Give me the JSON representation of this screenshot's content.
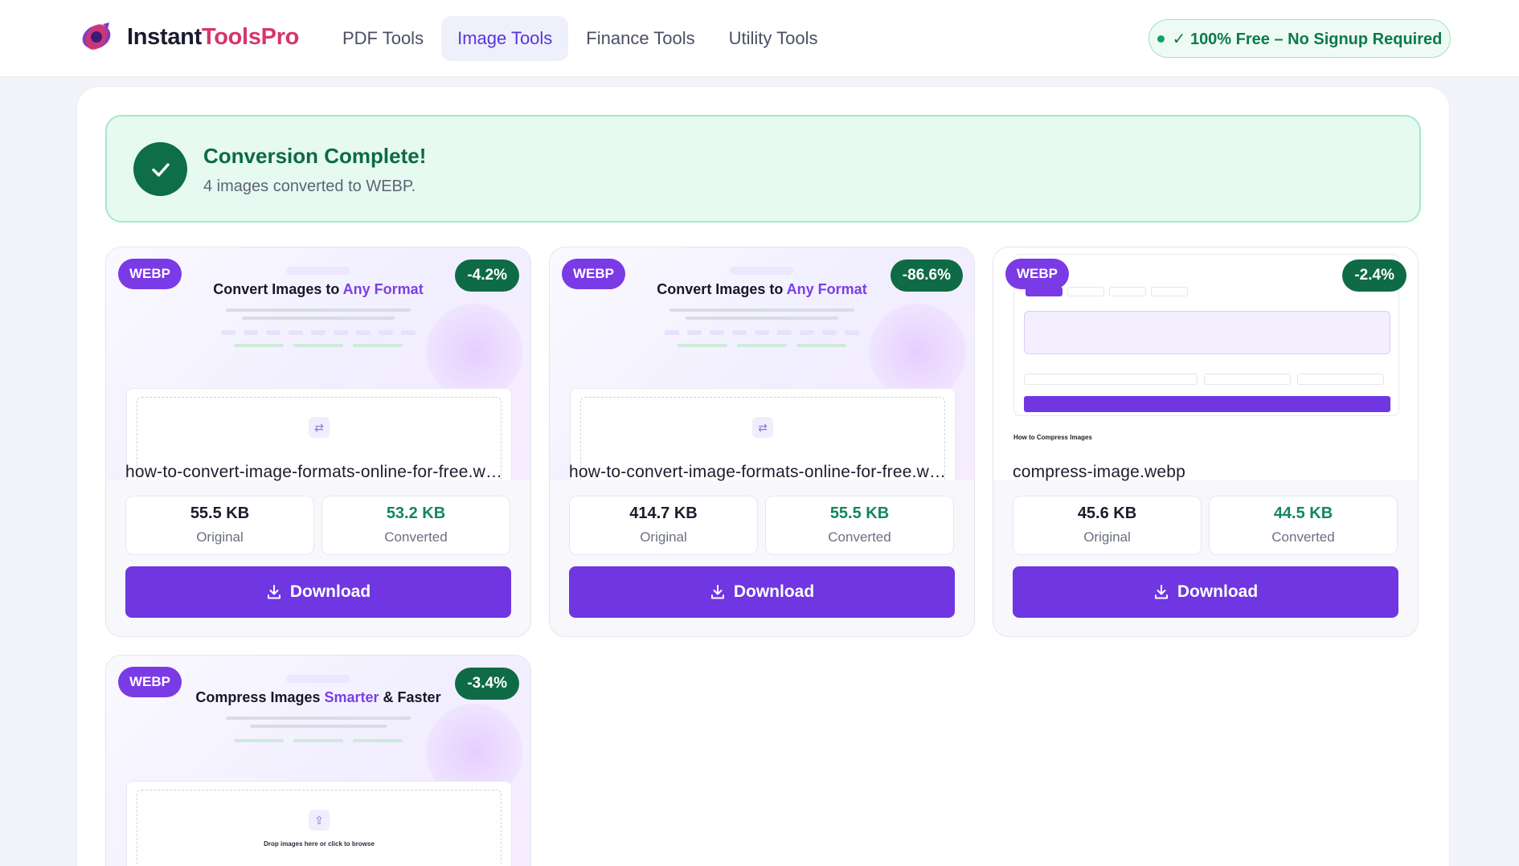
{
  "header": {
    "brand_part1": "Instant",
    "brand_part2": "ToolsPro",
    "nav": [
      {
        "label": "PDF Tools",
        "active": false
      },
      {
        "label": "Image Tools",
        "active": true
      },
      {
        "label": "Finance Tools",
        "active": false
      },
      {
        "label": "Utility Tools",
        "active": false
      }
    ],
    "badge": "✓ 100% Free – No Signup Required"
  },
  "result": {
    "title": "Conversion Complete!",
    "subtitle": "4 images converted to WEBP."
  },
  "cards": [
    {
      "format": "WEBP",
      "change": "-4.2%",
      "filename": "how-to-convert-image-formats-online-for-free.webp",
      "original_size": "55.5 KB",
      "converted_size": "53.2 KB",
      "original_label": "Original",
      "converted_label": "Converted",
      "download_label": "Download",
      "thumb_head_a": "Convert Images to ",
      "thumb_head_b": "Any Format"
    },
    {
      "format": "WEBP",
      "change": "-86.6%",
      "filename": "how-to-convert-image-formats-online-for-free.webp",
      "original_size": "414.7 KB",
      "converted_size": "55.5 KB",
      "original_label": "Original",
      "converted_label": "Converted",
      "download_label": "Download",
      "thumb_head_a": "Convert Images to ",
      "thumb_head_b": "Any Format"
    },
    {
      "format": "WEBP",
      "change": "-2.4%",
      "filename": "compress-image.webp",
      "original_size": "45.6 KB",
      "converted_size": "44.5 KB",
      "original_label": "Original",
      "converted_label": "Converted",
      "download_label": "Download",
      "thumb_section": "How to Compress Images"
    },
    {
      "format": "WEBP",
      "change": "-3.4%",
      "thumb_head_a": "Compress Images ",
      "thumb_head_b": "Smarter",
      "thumb_head_c": " & Faster",
      "thumb_drop": "Drop images here or click to browse"
    }
  ],
  "colors": {
    "accent": "#6f36e2",
    "success": "#0e6b46",
    "brand": "#d6356b"
  }
}
